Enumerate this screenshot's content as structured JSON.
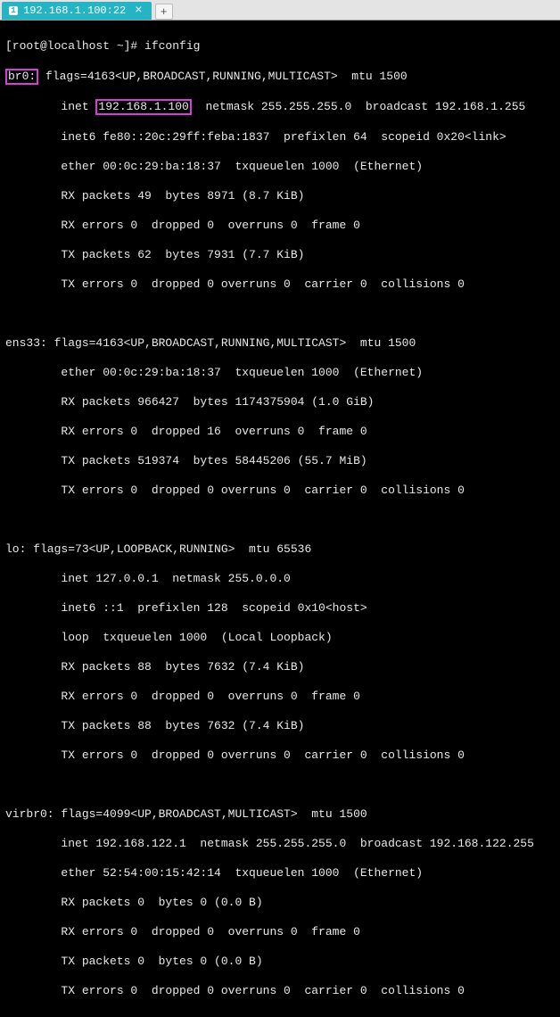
{
  "tab": {
    "index": "1",
    "title": "192.168.1.100:22",
    "close": "×",
    "plus": "+"
  },
  "prompt": "[root@localhost ~]# ",
  "command": "ifconfig",
  "if_br0": {
    "name": "br0:",
    "flags": " flags=4163<UP,BROADCAST,RUNNING,MULTICAST>  mtu 1500",
    "inet_pre": "        inet ",
    "inet_ip": "192.168.1.100",
    "inet_post": "  netmask 255.255.255.0  broadcast 192.168.1.255",
    "inet6": "        inet6 fe80::20c:29ff:feba:1837  prefixlen 64  scopeid 0x20<link>",
    "ether": "        ether 00:0c:29:ba:18:37  txqueuelen 1000  (Ethernet)",
    "rxp": "        RX packets 49  bytes 8971 (8.7 KiB)",
    "rxe": "        RX errors 0  dropped 0  overruns 0  frame 0",
    "txp": "        TX packets 62  bytes 7931 (7.7 KiB)",
    "txe": "        TX errors 0  dropped 0 overruns 0  carrier 0  collisions 0"
  },
  "if_ens33": {
    "head": "ens33: flags=4163<UP,BROADCAST,RUNNING,MULTICAST>  mtu 1500",
    "ether": "        ether 00:0c:29:ba:18:37  txqueuelen 1000  (Ethernet)",
    "rxp": "        RX packets 966427  bytes 1174375904 (1.0 GiB)",
    "rxe": "        RX errors 0  dropped 16  overruns 0  frame 0",
    "txp": "        TX packets 519374  bytes 58445206 (55.7 MiB)",
    "txe": "        TX errors 0  dropped 0 overruns 0  carrier 0  collisions 0"
  },
  "if_lo": {
    "head": "lo: flags=73<UP,LOOPBACK,RUNNING>  mtu 65536",
    "inet": "        inet 127.0.0.1  netmask 255.0.0.0",
    "inet6": "        inet6 ::1  prefixlen 128  scopeid 0x10<host>",
    "loop": "        loop  txqueuelen 1000  (Local Loopback)",
    "rxp": "        RX packets 88  bytes 7632 (7.4 KiB)",
    "rxe": "        RX errors 0  dropped 0  overruns 0  frame 0",
    "txp": "        TX packets 88  bytes 7632 (7.4 KiB)",
    "txe": "        TX errors 0  dropped 0 overruns 0  carrier 0  collisions 0"
  },
  "if_virbr0": {
    "head": "virbr0: flags=4099<UP,BROADCAST,MULTICAST>  mtu 1500",
    "inet": "        inet 192.168.122.1  netmask 255.255.255.0  broadcast 192.168.122.255",
    "ether": "        ether 52:54:00:15:42:14  txqueuelen 1000  (Ethernet)",
    "rxp": "        RX packets 0  bytes 0 (0.0 B)",
    "rxe": "        RX errors 0  dropped 0  overruns 0  frame 0",
    "txp": "        TX packets 0  bytes 0 (0.0 B)",
    "txe": "        TX errors 0  dropped 0 overruns 0  carrier 0  collisions 0"
  }
}
